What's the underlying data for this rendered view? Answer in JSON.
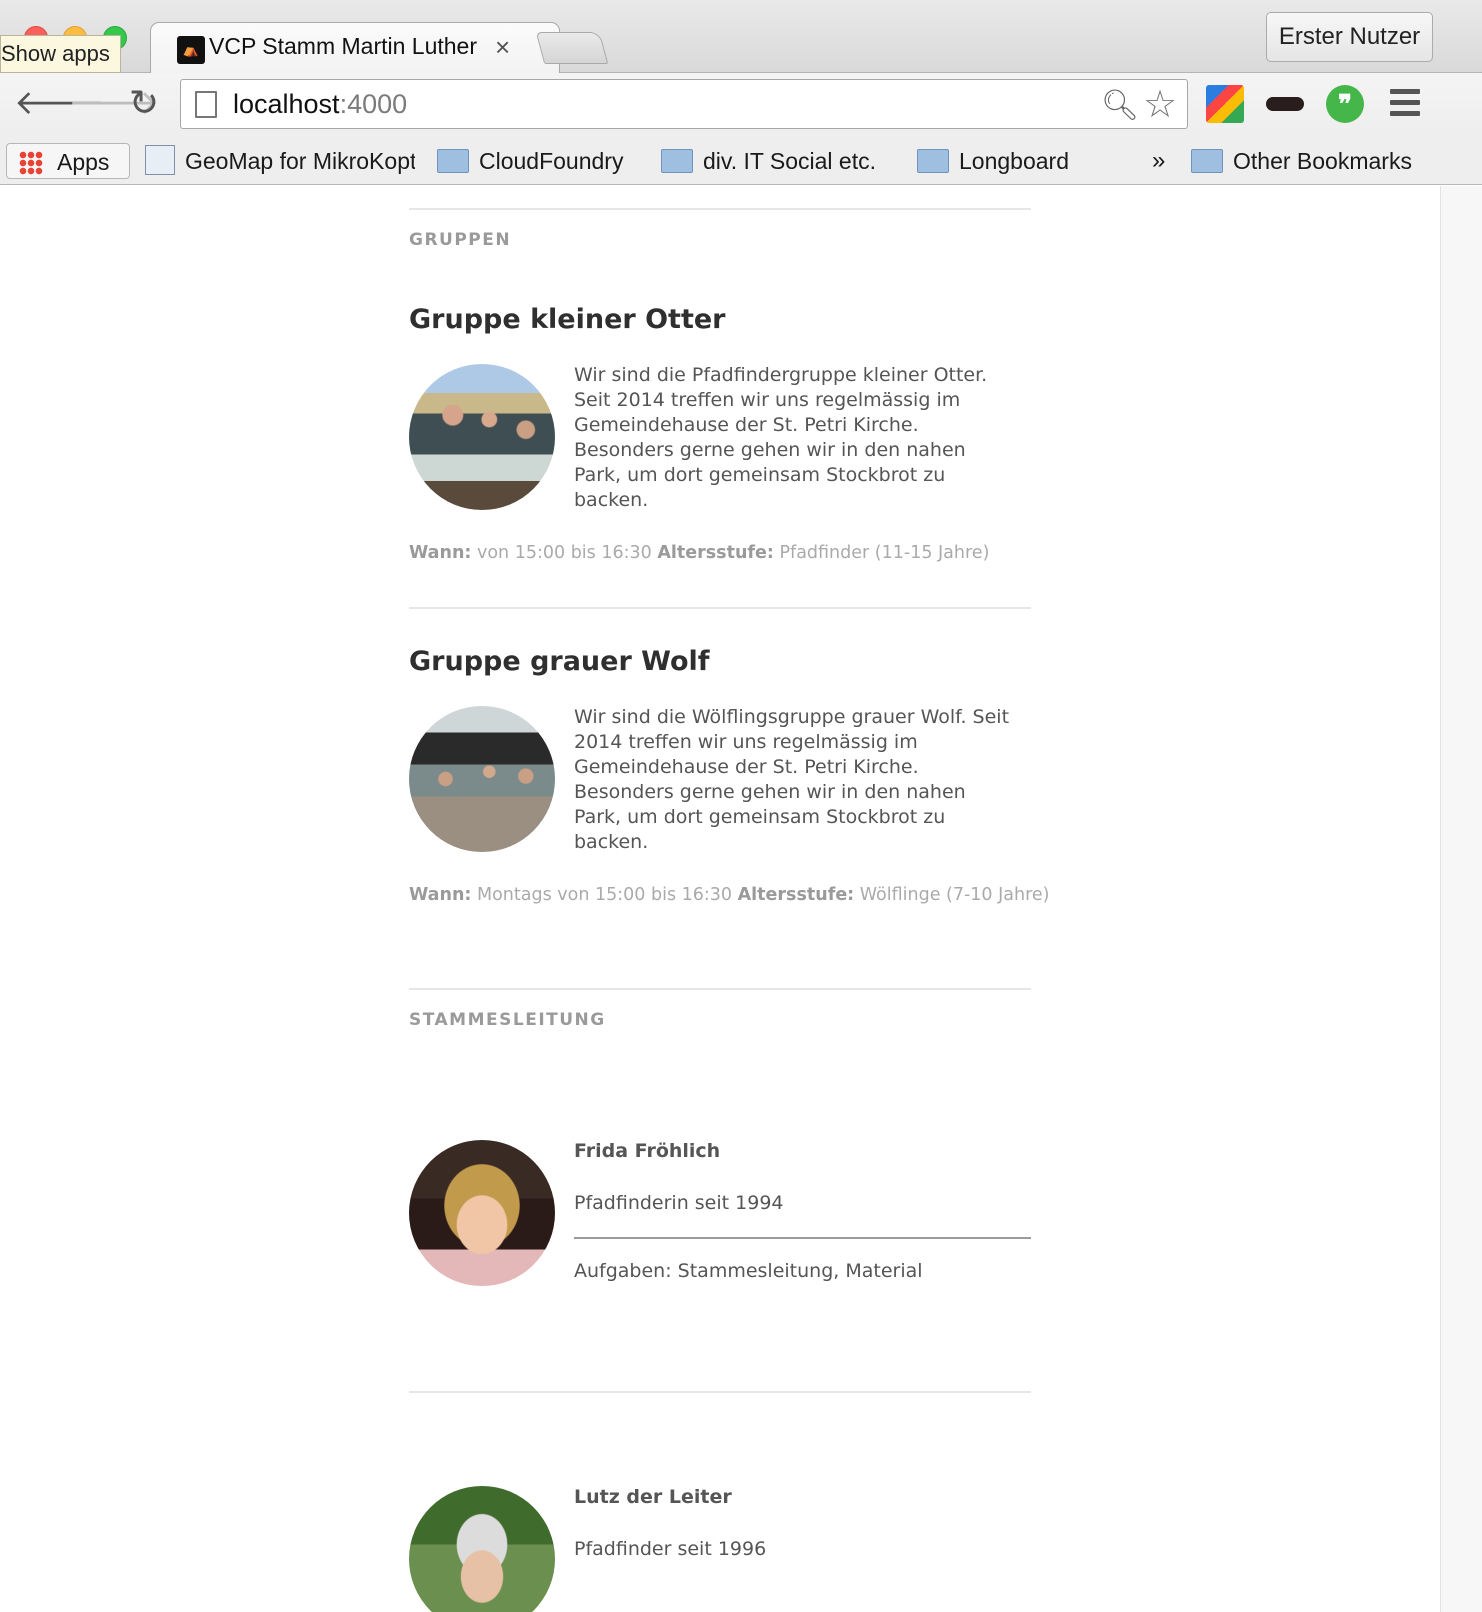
{
  "browser": {
    "tooltip": "Show apps",
    "tab": {
      "title": "VCP Stamm Martin Luther",
      "favicon": "tent-logo-icon"
    },
    "profile": "Erster Nutzer",
    "url": {
      "host": "localhost",
      "port": ":4000"
    },
    "bookmarks": {
      "apps": "Apps",
      "items": [
        "GeoMap for MikroKopter",
        "CloudFoundry",
        "div. IT Social etc.",
        "Longboard"
      ],
      "more": "»",
      "other": "Other Bookmarks"
    }
  },
  "page": {
    "groups_label": "GRUPPEN",
    "groups": [
      {
        "title": "Gruppe kleiner Otter",
        "description": "Wir sind die Pfadfindergruppe kleiner Otter. Seit 2014 treffen wir uns regelmässig im Gemeindehause der St. Petri Kirche. Besonders gerne gehen wir in den nahen Park, um dort gemeinsam Stockbrot zu backen.",
        "when_label": "Wann:",
        "when": "von 15:00 bis 16:30",
        "age_label": "Altersstufe:",
        "age": "Pfadfinder (11-15 Jahre)"
      },
      {
        "title": "Gruppe grauer Wolf",
        "description": "Wir sind die Wölflingsgruppe grauer Wolf. Seit 2014 treffen wir uns regelmässig im Gemeindehause der St. Petri Kirche. Besonders gerne gehen wir in den nahen Park, um dort gemeinsam Stockbrot zu backen.",
        "when_label": "Wann:",
        "when": "Montags von 15:00 bis 16:30",
        "age_label": "Altersstufe:",
        "age": "Wölflinge (7-10 Jahre)"
      }
    ],
    "leaders_label": "STAMMESLEITUNG",
    "leaders": [
      {
        "name": "Frida Fröhlich",
        "since": "Pfadfinderin seit 1994",
        "tasks": "Aufgaben: Stammesleitung, Material"
      },
      {
        "name": "Lutz der Leiter",
        "since": "Pfadfinder seit 1996"
      }
    ]
  }
}
